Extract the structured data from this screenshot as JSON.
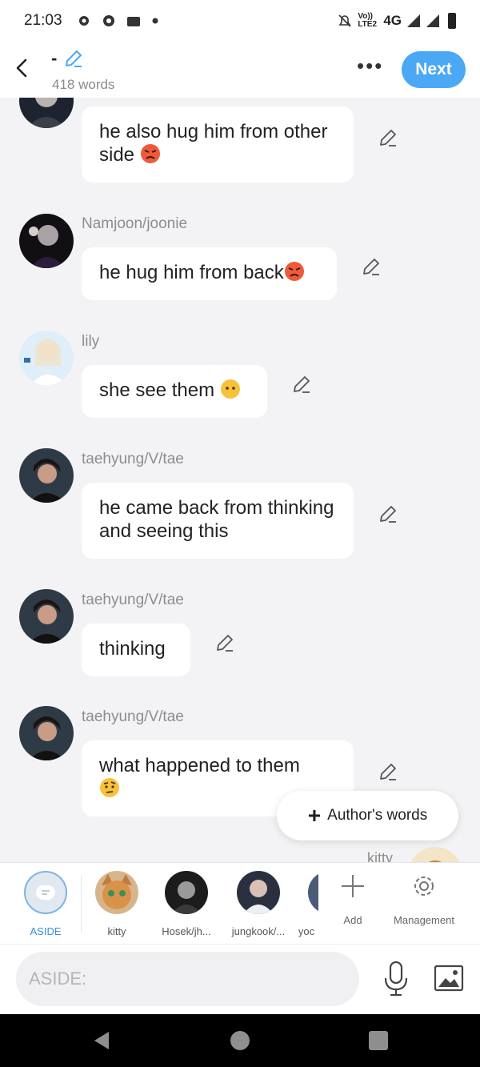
{
  "status_bar": {
    "time": "21:03",
    "network": "4G",
    "volte": "Vo)) LTE2"
  },
  "header": {
    "title": "-",
    "word_count": "418 words",
    "next_label": "Next"
  },
  "messages": [
    {
      "name": "",
      "text": "he also hug him from other side",
      "emoji": "angry"
    },
    {
      "name": "Namjoon/joonie",
      "text": "he hug him from back",
      "emoji": "angry"
    },
    {
      "name": "lily",
      "text": "she see them ",
      "emoji": "no-mouth"
    },
    {
      "name": "taehyung/V/tae",
      "text": "he came back from thinking and seeing this",
      "emoji": ""
    },
    {
      "name": "taehyung/V/tae",
      "text": "thinking",
      "emoji": ""
    },
    {
      "name": "taehyung/V/tae",
      "text": "what happened to them",
      "emoji": "raised-eyebrow"
    }
  ],
  "floating": {
    "authors_words": "Author's words",
    "peek_name": "kitty"
  },
  "characters": {
    "aside": "ASIDE",
    "kitty": "kitty",
    "hosek": "Hosek/jh...",
    "jungkook": "jungkook/...",
    "partial": "yoc",
    "add": "Add",
    "management": "Management"
  },
  "input": {
    "placeholder": "ASIDE:"
  },
  "colors": {
    "accent": "#4aa8f5",
    "angry_emoji": "#ef5a3c",
    "neutral_emoji": "#f7c23b"
  }
}
